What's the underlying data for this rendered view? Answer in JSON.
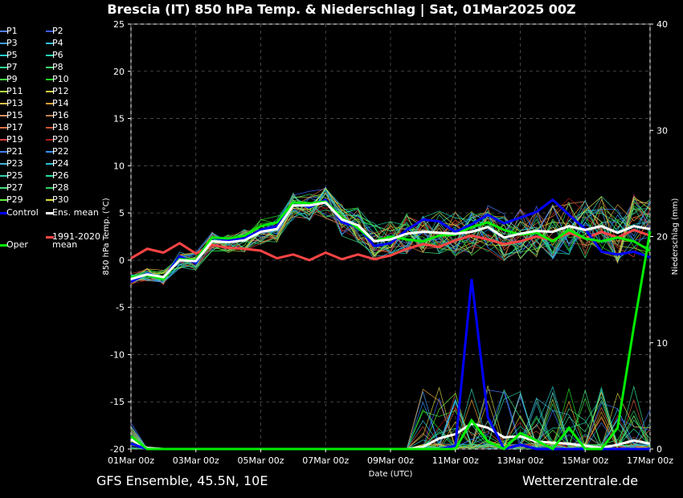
{
  "header": {
    "title": "Brescia  (IT)  850 hPa Temp. & Niederschlag | Sat, 01Mar2025 00Z"
  },
  "footer": {
    "left": "GFS Ensemble, 45.5N, 10E",
    "right": "Wetterzentrale.de"
  },
  "chart_data": {
    "type": "line",
    "xlabel": "Date (UTC)",
    "ylabel": "850 hPa Temp. (°C)",
    "y2label": "Niederschlag (mm)",
    "ylim": [
      -20,
      25
    ],
    "y2lim": [
      0,
      40
    ],
    "yticks": [
      -20,
      -15,
      -10,
      -5,
      0,
      5,
      10,
      15,
      20,
      25
    ],
    "y2ticks": [
      0,
      10,
      20,
      30,
      40
    ],
    "xticks": [
      "01Mar 00z",
      "03Mar 00z",
      "05Mar 00z",
      "07Mar 00z",
      "09Mar 00z",
      "11Mar 00z",
      "13Mar 00z",
      "15Mar 00z",
      "17Mar 00z"
    ],
    "grid": true,
    "x_hours": [
      0,
      12,
      24,
      36,
      48,
      60,
      72,
      84,
      96,
      108,
      120,
      132,
      144,
      156,
      168,
      180,
      192,
      204,
      216,
      228,
      240,
      252,
      264,
      276,
      288,
      300,
      312,
      324,
      336,
      348,
      360,
      372,
      384
    ],
    "series": [
      {
        "name": "Ens. mean",
        "color": "#ffffff",
        "temperature": [
          -2.0,
          -1.5,
          -1.8,
          0.0,
          -0.1,
          2.0,
          1.9,
          2.1,
          3.0,
          3.3,
          5.8,
          5.8,
          6.1,
          4.3,
          3.7,
          2.0,
          2.2,
          2.8,
          3.0,
          2.9,
          2.8,
          3.0,
          3.5,
          2.4,
          2.8,
          3.1,
          3.0,
          3.6,
          3.2,
          3.6,
          2.9,
          3.6,
          3.3
        ]
      },
      {
        "name": "Control",
        "color": "#0000ff",
        "temperature": [
          -2.3,
          -1.4,
          -1.9,
          0.4,
          -0.3,
          2.4,
          2.1,
          2.3,
          3.2,
          3.6,
          6.1,
          5.6,
          6.4,
          4.0,
          3.5,
          1.5,
          1.8,
          3.2,
          4.3,
          4.1,
          3.0,
          3.8,
          4.8,
          3.9,
          4.5,
          5.1,
          6.4,
          4.8,
          3.3,
          0.9,
          0.6,
          0.9,
          0.3
        ]
      },
      {
        "name": "Oper",
        "color": "#00ee00",
        "temperature": [
          -1.8,
          -1.6,
          -2.0,
          0.1,
          0.0,
          2.4,
          2.3,
          2.6,
          3.6,
          4.0,
          6.1,
          6.0,
          6.2,
          4.5,
          3.4,
          2.0,
          2.5,
          2.2,
          2.0,
          2.6,
          2.7,
          3.5,
          4.0,
          3.2,
          2.7,
          2.9,
          2.0,
          3.2,
          2.3,
          2.0,
          2.4,
          2.0,
          1.0
        ]
      },
      {
        "name": "1991-2020 mean",
        "color": "#ff4444",
        "temperature": [
          0.2,
          1.2,
          0.8,
          1.8,
          0.7,
          1.6,
          1.3,
          1.2,
          1.0,
          0.2,
          0.6,
          0.0,
          0.8,
          0.1,
          0.6,
          0.1,
          0.5,
          1.2,
          1.7,
          1.4,
          2.1,
          2.6,
          2.2,
          1.7,
          2.0,
          2.5,
          2.1,
          2.9,
          2.3,
          3.0,
          2.4,
          3.2,
          2.6
        ]
      }
    ],
    "precipitation": [
      {
        "name": "Ens. mean",
        "color": "#ffffff",
        "values": [
          0.9,
          0.1,
          0,
          0,
          0,
          0,
          0,
          0,
          0,
          0,
          0,
          0,
          0,
          0,
          0,
          0,
          0,
          0,
          0.2,
          1.0,
          1.4,
          2.4,
          2.0,
          1.1,
          1.2,
          0.7,
          0.6,
          0.5,
          0.3,
          0.1,
          0.4,
          0.8,
          0.5
        ]
      },
      {
        "name": "Control",
        "color": "#0000ff",
        "values": [
          0.5,
          0,
          0,
          0,
          0,
          0,
          0,
          0,
          0,
          0,
          0,
          0,
          0,
          0,
          0,
          0,
          0,
          0,
          0,
          0,
          0.3,
          16.0,
          3.0,
          0,
          0.4,
          0,
          0,
          0,
          0,
          0,
          0,
          0,
          0
        ]
      },
      {
        "name": "Oper",
        "color": "#00ee00",
        "values": [
          1.2,
          0,
          0,
          0,
          0,
          0,
          0,
          0,
          0,
          0,
          0,
          0,
          0,
          0,
          0,
          0,
          0,
          0,
          0,
          0,
          0,
          2.7,
          0.7,
          0,
          1.5,
          0.8,
          0,
          2.0,
          0,
          0,
          2.0,
          11.5,
          20.5
        ]
      }
    ]
  },
  "legend": {
    "members": [
      {
        "label": "P1",
        "color": "#4f7fff"
      },
      {
        "label": "P2",
        "color": "#3f5fff"
      },
      {
        "label": "P3",
        "color": "#40a0ff"
      },
      {
        "label": "P4",
        "color": "#30c0e0"
      },
      {
        "label": "P5",
        "color": "#20d0d0"
      },
      {
        "label": "P6",
        "color": "#20e0b0"
      },
      {
        "label": "P7",
        "color": "#30e090"
      },
      {
        "label": "P8",
        "color": "#40e070"
      },
      {
        "label": "P9",
        "color": "#40f040"
      },
      {
        "label": "P10",
        "color": "#20e020"
      },
      {
        "label": "P11",
        "color": "#b0e040"
      },
      {
        "label": "P12",
        "color": "#d0d040"
      },
      {
        "label": "P13",
        "color": "#e0c040"
      },
      {
        "label": "P14",
        "color": "#e0a030"
      },
      {
        "label": "P15",
        "color": "#e09060"
      },
      {
        "label": "P16",
        "color": "#c08050"
      },
      {
        "label": "P17",
        "color": "#e07040"
      },
      {
        "label": "P18",
        "color": "#d05030"
      },
      {
        "label": "P19",
        "color": "#e04040"
      },
      {
        "label": "P20",
        "color": "#b02020"
      },
      {
        "label": "P21",
        "color": "#4080ff"
      },
      {
        "label": "P22",
        "color": "#3090ff"
      },
      {
        "label": "P23",
        "color": "#40b0e0"
      },
      {
        "label": "P24",
        "color": "#30c0d0"
      },
      {
        "label": "P25",
        "color": "#30d0b0"
      },
      {
        "label": "P26",
        "color": "#20e0a0"
      },
      {
        "label": "P27",
        "color": "#40e080"
      },
      {
        "label": "P28",
        "color": "#30d060"
      },
      {
        "label": "P29",
        "color": "#60f040"
      },
      {
        "label": "P30",
        "color": "#e0e040"
      }
    ],
    "control": {
      "label": "Control",
      "color": "#0000ff"
    },
    "mean": {
      "label": "Ens. mean",
      "color": "#ffffff"
    },
    "oper": {
      "label": "Oper",
      "color": "#00ee00"
    },
    "climate": {
      "label1": "1991-2020",
      "label2": "mean",
      "color": "#ff4444"
    }
  }
}
